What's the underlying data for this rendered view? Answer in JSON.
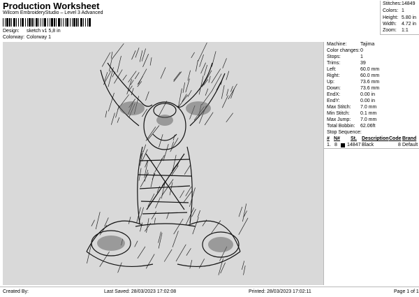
{
  "header": {
    "title": "Production Worksheet",
    "subtitle": "Wilcom EmbroideryStudio – Level 3 Advanced",
    "design_label": "Design:",
    "design_value": "sketch v1 5,8 in",
    "colorway_label": "Colorway:",
    "colorway_value": "Colorway 1"
  },
  "summary": [
    {
      "label": "Stitches:",
      "value": "14849"
    },
    {
      "label": "Colors:",
      "value": "1"
    },
    {
      "label": "Height:",
      "value": "5.80 in"
    },
    {
      "label": "Width:",
      "value": "4.72 in"
    },
    {
      "label": "Zoom:",
      "value": "1:1"
    }
  ],
  "info": [
    {
      "label": "Machine:",
      "value": "Tajima"
    },
    {
      "label": "Color changes:",
      "value": "0"
    },
    {
      "label": "Stops:",
      "value": "1"
    },
    {
      "label": "Trims:",
      "value": "39"
    },
    {
      "label": "Left:",
      "value": "60.0 mm"
    },
    {
      "label": "Right:",
      "value": "60.0 mm"
    },
    {
      "label": "Up:",
      "value": "73.6 mm"
    },
    {
      "label": "Down:",
      "value": "73.6 mm"
    },
    {
      "label": "EndX:",
      "value": "0.00 in"
    },
    {
      "label": "EndY:",
      "value": "0.00 in"
    },
    {
      "label": "Max Stitch:",
      "value": "7.0 mm"
    },
    {
      "label": "Min Stitch:",
      "value": "0.1 mm"
    },
    {
      "label": "Max Jump:",
      "value": "7.0 mm"
    },
    {
      "label": "Total Bobbin:",
      "value": "62.06ft"
    }
  ],
  "stop_sequence": {
    "label": "Stop Sequence:",
    "columns": {
      "num": "#",
      "n": "N#",
      "st": "St.",
      "description": "Description",
      "code": "Code",
      "brand": "Brand"
    },
    "rows": [
      {
        "num": "1.",
        "n": "8",
        "swatch_color": "#000000",
        "st": "14847",
        "description": "Black",
        "code": "8",
        "brand": "Default"
      }
    ]
  },
  "footer": {
    "created_by": "Created By:",
    "last_saved": "Last Saved: 28/03/2023 17:02:08",
    "printed": "Printed: 28/03/2023 17:02:11",
    "page": "Page 1 of 1"
  },
  "colors": {
    "design_background": "#d9d9d9",
    "thread": "#000000"
  }
}
